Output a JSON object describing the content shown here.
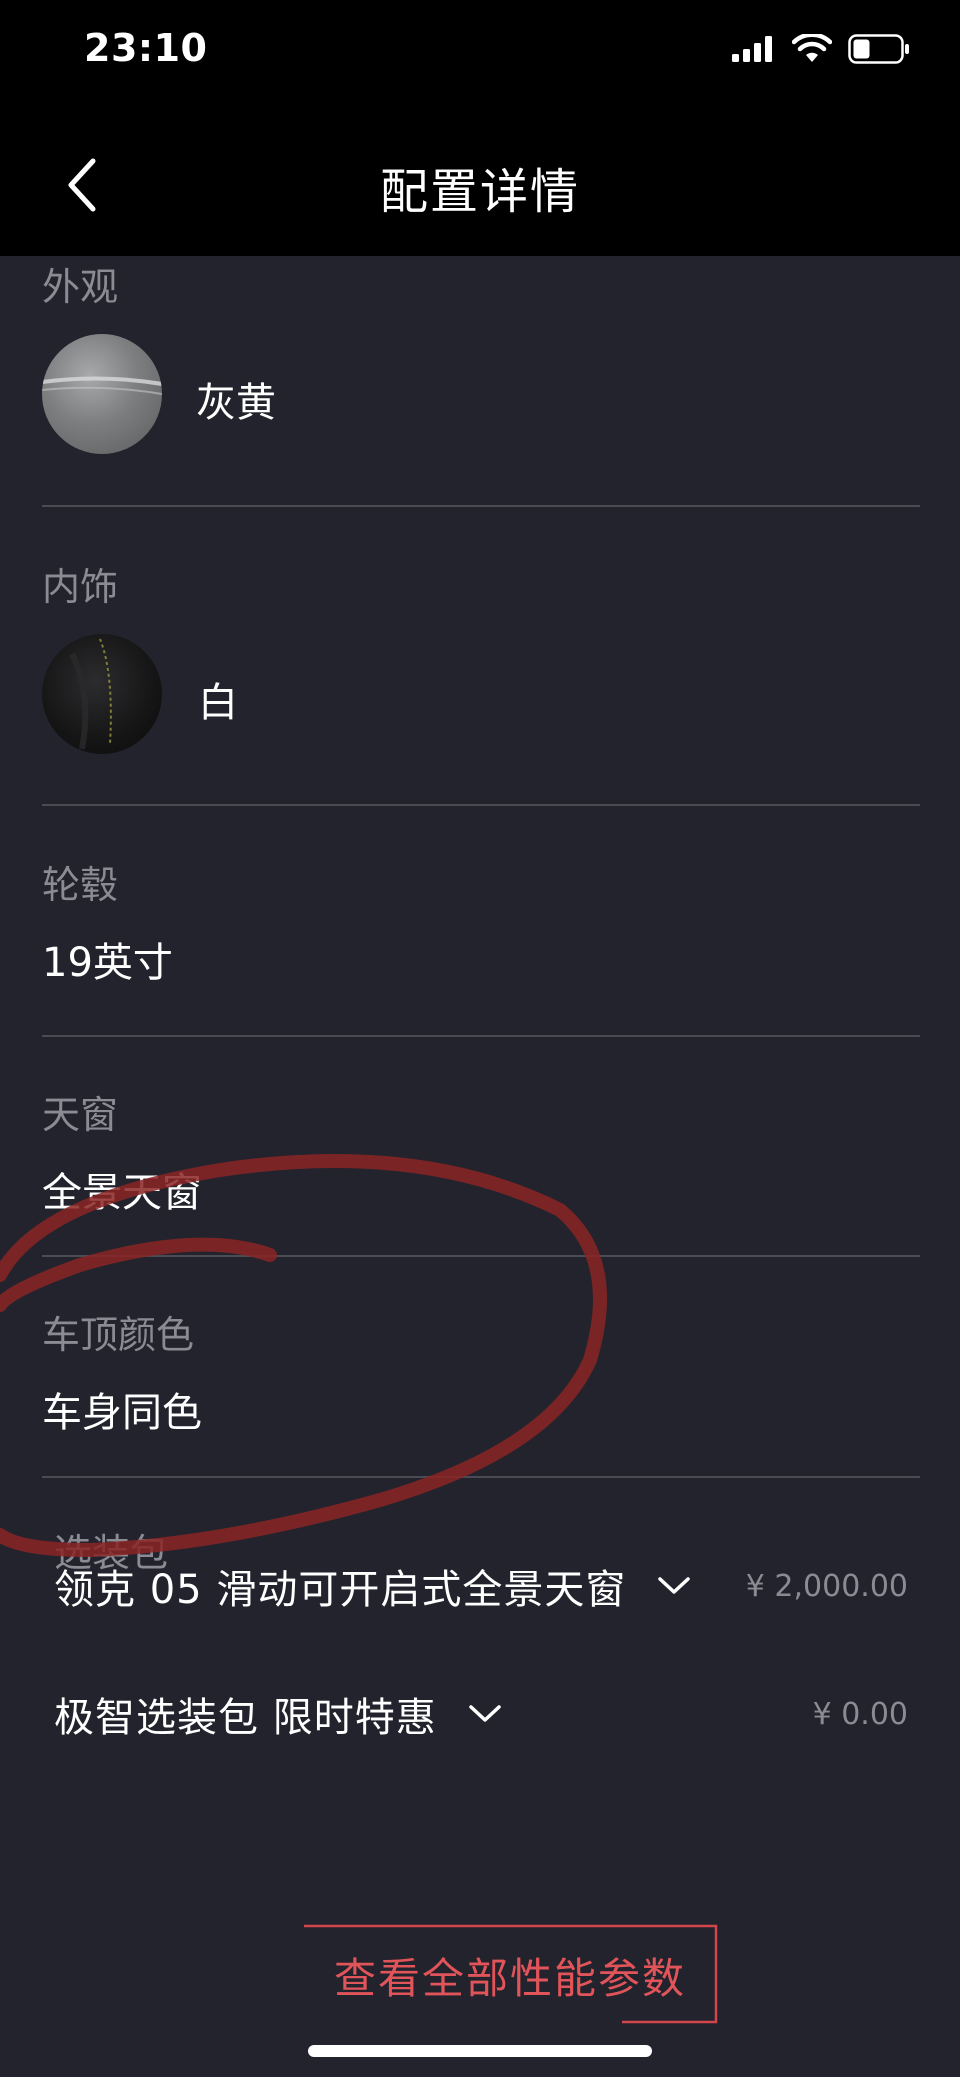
{
  "status_bar": {
    "time": "23:10"
  },
  "nav": {
    "title": "配置详情"
  },
  "exterior": {
    "label": "外观",
    "value": "灰黄"
  },
  "interior": {
    "label": "内饰",
    "value": "白"
  },
  "wheels": {
    "label": "轮毂",
    "value": "19英寸"
  },
  "sunroof": {
    "label": "天窗",
    "value": "全景天窗"
  },
  "roof_color": {
    "label": "车顶颜色",
    "value": "车身同色"
  },
  "packages": {
    "label": "选装包",
    "items": [
      {
        "name": "领克 05 滑动可开启式全景天窗",
        "price": "¥ 2,000.00"
      },
      {
        "name": "极智选装包 限时特惠",
        "price": "¥ 0.00"
      }
    ]
  },
  "footer": {
    "view_all_label": "查看全部性能参数"
  },
  "colors": {
    "background": "#22232c",
    "accent": "#e0545a",
    "annotation": "#8b2424"
  }
}
